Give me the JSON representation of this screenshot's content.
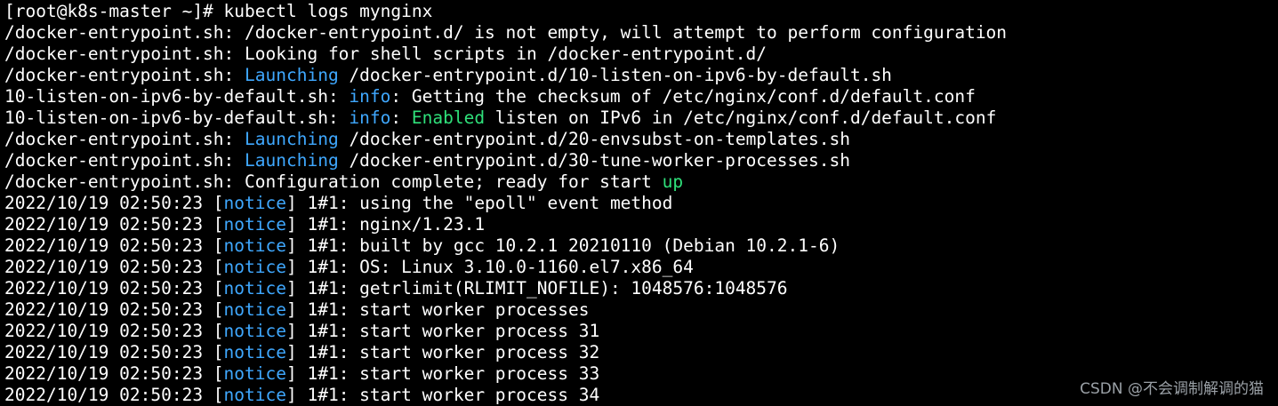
{
  "terminal": {
    "colors": {
      "background": "#000000",
      "text": "#ffffff",
      "highlight_blue": "#3fa8ff",
      "highlight_green": "#2fe07a",
      "watermark": "#9aa0a6"
    },
    "lines": [
      {
        "segments": [
          {
            "text": "[root@k8s-master ~]# kubectl logs mynginx",
            "style": "plain"
          }
        ]
      },
      {
        "segments": [
          {
            "text": "/docker-entrypoint.sh: /docker-entrypoint.d/ is not empty, will attempt to perform configuration",
            "style": "plain"
          }
        ]
      },
      {
        "segments": [
          {
            "text": "/docker-entrypoint.sh: Looking for shell scripts in /docker-entrypoint.d/",
            "style": "plain"
          }
        ]
      },
      {
        "segments": [
          {
            "text": "/docker-entrypoint.sh: ",
            "style": "plain"
          },
          {
            "text": "Launching",
            "style": "hl-blue"
          },
          {
            "text": " /docker-entrypoint.d/10-listen-on-ipv6-by-default.sh",
            "style": "plain"
          }
        ]
      },
      {
        "segments": [
          {
            "text": "10-listen-on-ipv6-by-default.sh: ",
            "style": "plain"
          },
          {
            "text": "info",
            "style": "hl-blue"
          },
          {
            "text": ": Getting the checksum of /etc/nginx/conf.d/default.conf",
            "style": "plain"
          }
        ]
      },
      {
        "segments": [
          {
            "text": "10-listen-on-ipv6-by-default.sh: ",
            "style": "plain"
          },
          {
            "text": "info",
            "style": "hl-blue"
          },
          {
            "text": ": ",
            "style": "plain"
          },
          {
            "text": "Enabled",
            "style": "hl-green"
          },
          {
            "text": " listen on IPv6 in /etc/nginx/conf.d/default.conf",
            "style": "plain"
          }
        ]
      },
      {
        "segments": [
          {
            "text": "/docker-entrypoint.sh: ",
            "style": "plain"
          },
          {
            "text": "Launching",
            "style": "hl-blue"
          },
          {
            "text": " /docker-entrypoint.d/20-envsubst-on-templates.sh",
            "style": "plain"
          }
        ]
      },
      {
        "segments": [
          {
            "text": "/docker-entrypoint.sh: ",
            "style": "plain"
          },
          {
            "text": "Launching",
            "style": "hl-blue"
          },
          {
            "text": " /docker-entrypoint.d/30-tune-worker-processes.sh",
            "style": "plain"
          }
        ]
      },
      {
        "segments": [
          {
            "text": "/docker-entrypoint.sh: Configuration complete; ready for start ",
            "style": "plain"
          },
          {
            "text": "up",
            "style": "hl-green"
          }
        ]
      },
      {
        "segments": [
          {
            "text": "2022/10/19 02:50:23 [",
            "style": "plain"
          },
          {
            "text": "notice",
            "style": "hl-blue"
          },
          {
            "text": "] 1#1: using the \"epoll\" event method",
            "style": "plain"
          }
        ]
      },
      {
        "segments": [
          {
            "text": "2022/10/19 02:50:23 [",
            "style": "plain"
          },
          {
            "text": "notice",
            "style": "hl-blue"
          },
          {
            "text": "] 1#1: nginx/1.23.1",
            "style": "plain"
          }
        ]
      },
      {
        "segments": [
          {
            "text": "2022/10/19 02:50:23 [",
            "style": "plain"
          },
          {
            "text": "notice",
            "style": "hl-blue"
          },
          {
            "text": "] 1#1: built by gcc 10.2.1 20210110 (Debian 10.2.1-6)",
            "style": "plain"
          }
        ]
      },
      {
        "segments": [
          {
            "text": "2022/10/19 02:50:23 [",
            "style": "plain"
          },
          {
            "text": "notice",
            "style": "hl-blue"
          },
          {
            "text": "] 1#1: OS: Linux 3.10.0-1160.el7.x86_64",
            "style": "plain"
          }
        ]
      },
      {
        "segments": [
          {
            "text": "2022/10/19 02:50:23 [",
            "style": "plain"
          },
          {
            "text": "notice",
            "style": "hl-blue"
          },
          {
            "text": "] 1#1: getrlimit(RLIMIT_NOFILE): 1048576:1048576",
            "style": "plain"
          }
        ]
      },
      {
        "segments": [
          {
            "text": "2022/10/19 02:50:23 [",
            "style": "plain"
          },
          {
            "text": "notice",
            "style": "hl-blue"
          },
          {
            "text": "] 1#1: start worker processes",
            "style": "plain"
          }
        ]
      },
      {
        "segments": [
          {
            "text": "2022/10/19 02:50:23 [",
            "style": "plain"
          },
          {
            "text": "notice",
            "style": "hl-blue"
          },
          {
            "text": "] 1#1: start worker process 31",
            "style": "plain"
          }
        ]
      },
      {
        "segments": [
          {
            "text": "2022/10/19 02:50:23 [",
            "style": "plain"
          },
          {
            "text": "notice",
            "style": "hl-blue"
          },
          {
            "text": "] 1#1: start worker process 32",
            "style": "plain"
          }
        ]
      },
      {
        "segments": [
          {
            "text": "2022/10/19 02:50:23 [",
            "style": "plain"
          },
          {
            "text": "notice",
            "style": "hl-blue"
          },
          {
            "text": "] 1#1: start worker process 33",
            "style": "plain"
          }
        ]
      },
      {
        "segments": [
          {
            "text": "2022/10/19 02:50:23 [",
            "style": "plain"
          },
          {
            "text": "notice",
            "style": "hl-blue"
          },
          {
            "text": "] 1#1: start worker process 34",
            "style": "plain"
          }
        ]
      }
    ]
  },
  "watermark": {
    "text": "CSDN @不会调制解调的猫"
  }
}
